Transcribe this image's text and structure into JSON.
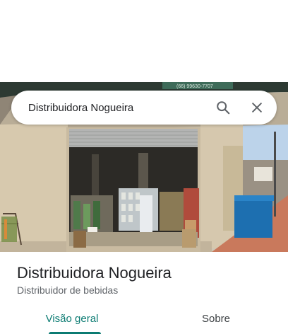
{
  "search": {
    "query": "Distribuidora Nogueira",
    "search_icon": "search-icon",
    "close_icon": "close-icon"
  },
  "photo": {
    "signboard_text": "(66) 99630-7707",
    "description_icon": "storefront-photo"
  },
  "place": {
    "title": "Distribuidora Nogueira",
    "category": "Distribuidor de bebidas"
  },
  "tabs": [
    {
      "label": "Visão geral",
      "active": true
    },
    {
      "label": "Sobre",
      "active": false
    }
  ],
  "colors": {
    "accent": "#0b7b72",
    "title": "#202124",
    "secondary": "#5f6368"
  }
}
